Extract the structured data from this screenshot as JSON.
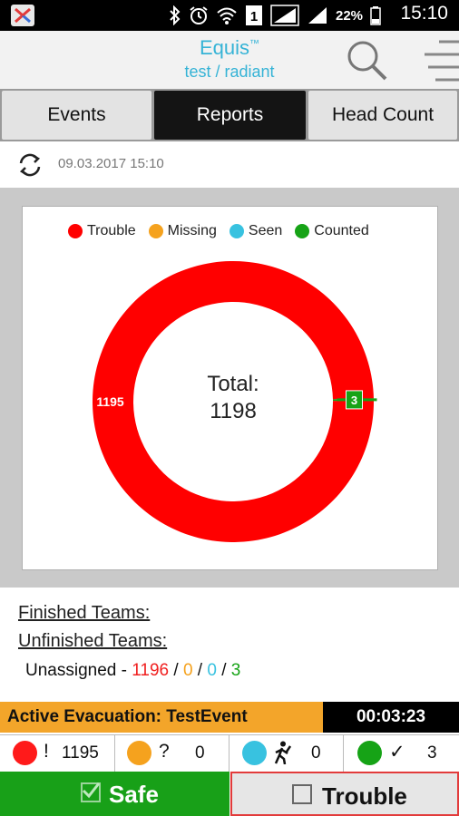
{
  "status_bar": {
    "icons": [
      "app-icon",
      "bluetooth-icon",
      "alarm-icon",
      "wifi-icon",
      "sim-1-icon",
      "signal-icon",
      "signal-icon"
    ],
    "battery": "22%",
    "time": "15:10"
  },
  "header": {
    "title": "Equis",
    "trademark": "™",
    "subtitle": "test / radiant"
  },
  "tabs": [
    {
      "label": "Events",
      "active": false
    },
    {
      "label": "Reports",
      "active": true
    },
    {
      "label": "Head Count",
      "active": false
    }
  ],
  "refresh": {
    "timestamp": "09.03.2017 15:10"
  },
  "chart_data": {
    "type": "pie",
    "donut": true,
    "legend": [
      "Trouble",
      "Missing",
      "Seen",
      "Counted"
    ],
    "legend_position": "top",
    "center_label": "Total:",
    "center_value": "1198",
    "slices": [
      {
        "name": "Trouble",
        "value": 1195,
        "color": "#ff0000",
        "label": "1195"
      },
      {
        "name": "Missing",
        "value": 0,
        "color": "#f5a21e",
        "label": ""
      },
      {
        "name": "Seen",
        "value": 0,
        "color": "#38c2e0",
        "label": ""
      },
      {
        "name": "Counted",
        "value": 3,
        "color": "#16a316",
        "label": "3"
      }
    ]
  },
  "teams": {
    "finished_label": "Finished Teams:",
    "unfinished_label": "Unfinished Teams:",
    "unassigned_label": "Unassigned -",
    "unassigned_trouble": "1196",
    "unassigned_missing": "0",
    "unassigned_seen": "0",
    "unassigned_counted": "3",
    "separator": "/"
  },
  "evacuation": {
    "label": "Active Evacuation: TestEvent",
    "timer": "00:03:23"
  },
  "counts": [
    {
      "color": "#ff1a1a",
      "symbol": "!",
      "value": "1195"
    },
    {
      "color": "#f5a21e",
      "symbol": "?",
      "value": "0"
    },
    {
      "color": "#38c2e0",
      "symbol": "walking-person-icon",
      "value": "0"
    },
    {
      "color": "#16a316",
      "symbol": "✓",
      "value": "3"
    }
  ],
  "buttons": {
    "safe_label": "Safe",
    "trouble_label": "Trouble"
  },
  "colors": {
    "accent": "#35b3d6",
    "safe": "#18a018",
    "trouble": "#ff0000",
    "evac": "#f3a52a"
  }
}
